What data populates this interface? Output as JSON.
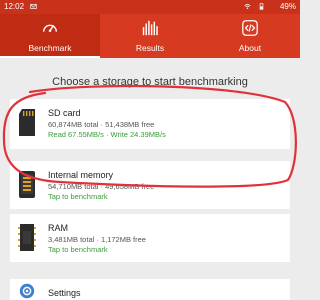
{
  "status_bar": {
    "time": "12:02",
    "battery": "49%",
    "icons": [
      "wifi-icon",
      "battery-icon",
      "mail-icon"
    ]
  },
  "tabs": [
    {
      "label": "Benchmark",
      "icon": "speedometer-icon",
      "active": true
    },
    {
      "label": "Results",
      "icon": "bar-chart-icon",
      "active": false
    },
    {
      "label": "About",
      "icon": "info-code-icon",
      "active": false
    }
  ],
  "prompt": "Choose a storage to start benchmarking",
  "storages": [
    {
      "title": "SD card",
      "details": "60,874MB total · 51,438MB free",
      "action": "Read 67.55MB/s · Write 24.39MB/s",
      "icon": "sd-card-icon"
    },
    {
      "title": "Internal memory",
      "details": "54,710MB total · 49,658MB free",
      "action": "Tap to benchmark",
      "icon": "phone-icon"
    },
    {
      "title": "RAM",
      "details": "3,481MB total · 1,172MB free",
      "action": "Tap to benchmark",
      "icon": "ram-chip-icon"
    }
  ],
  "settings": {
    "label": "Settings",
    "icon": "gear-icon"
  },
  "colors": {
    "accent": "#d63a21",
    "accent_dark": "#c02b13",
    "success": "#3a9c3a",
    "highlight": "#e0323b"
  }
}
